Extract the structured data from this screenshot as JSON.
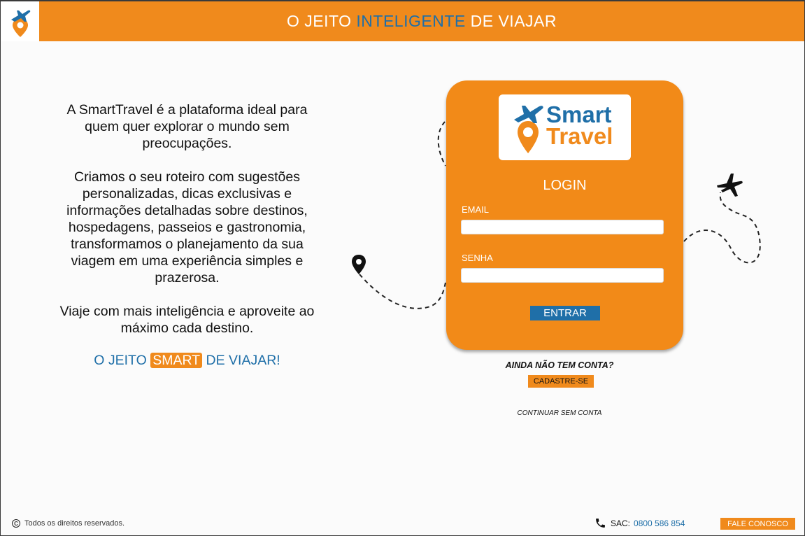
{
  "header": {
    "title_part1": "O JEITO ",
    "title_accent": "INTELIGENTE",
    "title_part2": " DE VIAJAR"
  },
  "brand": {
    "line1": "Smart",
    "line2": "Travel"
  },
  "intro": {
    "p1": "A SmartTravel é a plataforma ideal para quem quer explorar o mundo sem preocupações.",
    "p2": "Criamos o seu roteiro com sugestões personalizadas, dicas exclusivas e informações detalhadas sobre destinos, hospedagens, passeios e gastronomia, transformamos o planejamento da sua viagem em uma experiência simples e prazerosa.",
    "p3": "Viaje com mais inteligência e aproveite ao máximo cada destino."
  },
  "slogan": {
    "part1": "O JEITO ",
    "highlight": "SMART",
    "part2": " DE VIAJAR!"
  },
  "login": {
    "title": "LOGIN",
    "email_label": "EMAIL",
    "email_value": "",
    "password_label": "SENHA",
    "password_value": "",
    "submit_label": "ENTRAR"
  },
  "signup": {
    "question": "AINDA NÃO TEM CONTA?",
    "button_label": "CADASTRE-SE",
    "guest_link": "CONTINUAR SEM CONTA"
  },
  "footer": {
    "copyright_symbol": "C",
    "copyright": "Todos os direitos reservados.",
    "sac_label": "SAC:",
    "sac_number": "0800 586 854",
    "contact_label": "FALE CONOSCO"
  },
  "colors": {
    "primary_orange": "#f08a1c",
    "accent_blue": "#1f6fa8"
  },
  "icons": [
    "plane-pin-logo-icon",
    "airplane-icon",
    "map-pin-icon",
    "phone-icon",
    "copyright-icon"
  ]
}
